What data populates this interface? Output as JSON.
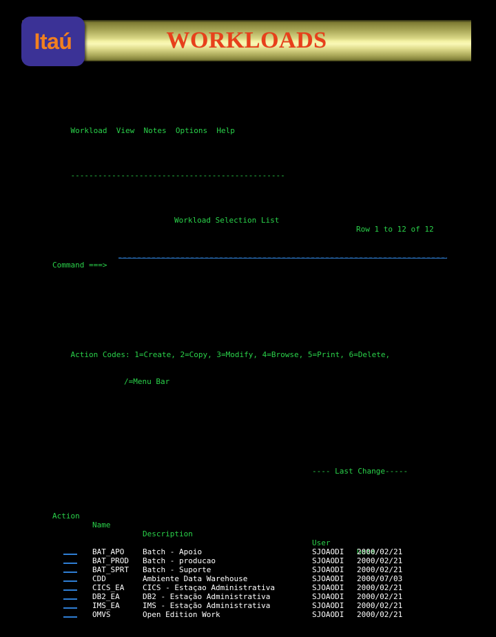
{
  "banner": {
    "logo_text": "Itaú",
    "title": "WORKLOADS",
    "logo_bg": "#3b3296",
    "logo_fg": "#f2801f",
    "title_color": "#e8401b"
  },
  "terminal": {
    "menubar": "Workload  View  Notes  Options  Help",
    "separator": "-----------------------------------------------",
    "screen_title": "Workload Selection List",
    "row_counter": "Row 1 to 12 of 12",
    "command_label": "Command ===>",
    "command_value": "",
    "action_codes_line1": "Action Codes: 1=Create, 2=Copy, 3=Modify, 4=Browse, 5=Print, 6=Delete,",
    "action_codes_line2": "/=Menu Bar",
    "last_change_header": "---- Last Change-----",
    "columns": {
      "action": "Action",
      "name": "Name",
      "description": "Description",
      "user": "User",
      "date": "Date"
    },
    "rows": [
      {
        "action": "",
        "name": "BAT_APO",
        "description": "Batch - Apoio",
        "user": "SJOAODI",
        "date": "2000/02/21"
      },
      {
        "action": "",
        "name": "BAT_PROD",
        "description": "Batch - producao",
        "user": "SJOAODI",
        "date": "2000/02/21"
      },
      {
        "action": "",
        "name": "BAT_SPRT",
        "description": "Batch - Suporte",
        "user": "SJOAODI",
        "date": "2000/02/21"
      },
      {
        "action": "",
        "name": "CDD",
        "description": "Ambiente Data Warehouse",
        "user": "SJOAODI",
        "date": "2000/07/03"
      },
      {
        "action": "",
        "name": "CICS_EA",
        "description": "CICS - Estaçao Administrativa",
        "user": "SJOAODI",
        "date": "2000/02/21"
      },
      {
        "action": "",
        "name": "DB2_EA",
        "description": "DB2 - Estação Administrativa",
        "user": "SJOAODI",
        "date": "2000/02/21"
      },
      {
        "action": "",
        "name": "IMS_EA",
        "description": "IMS - Estação Administrativa",
        "user": "SJOAODI",
        "date": "2000/02/21"
      },
      {
        "action": "",
        "name": "OMVS",
        "description": "Open Edition Work",
        "user": "SJOAODI",
        "date": "2000/02/21"
      }
    ]
  }
}
